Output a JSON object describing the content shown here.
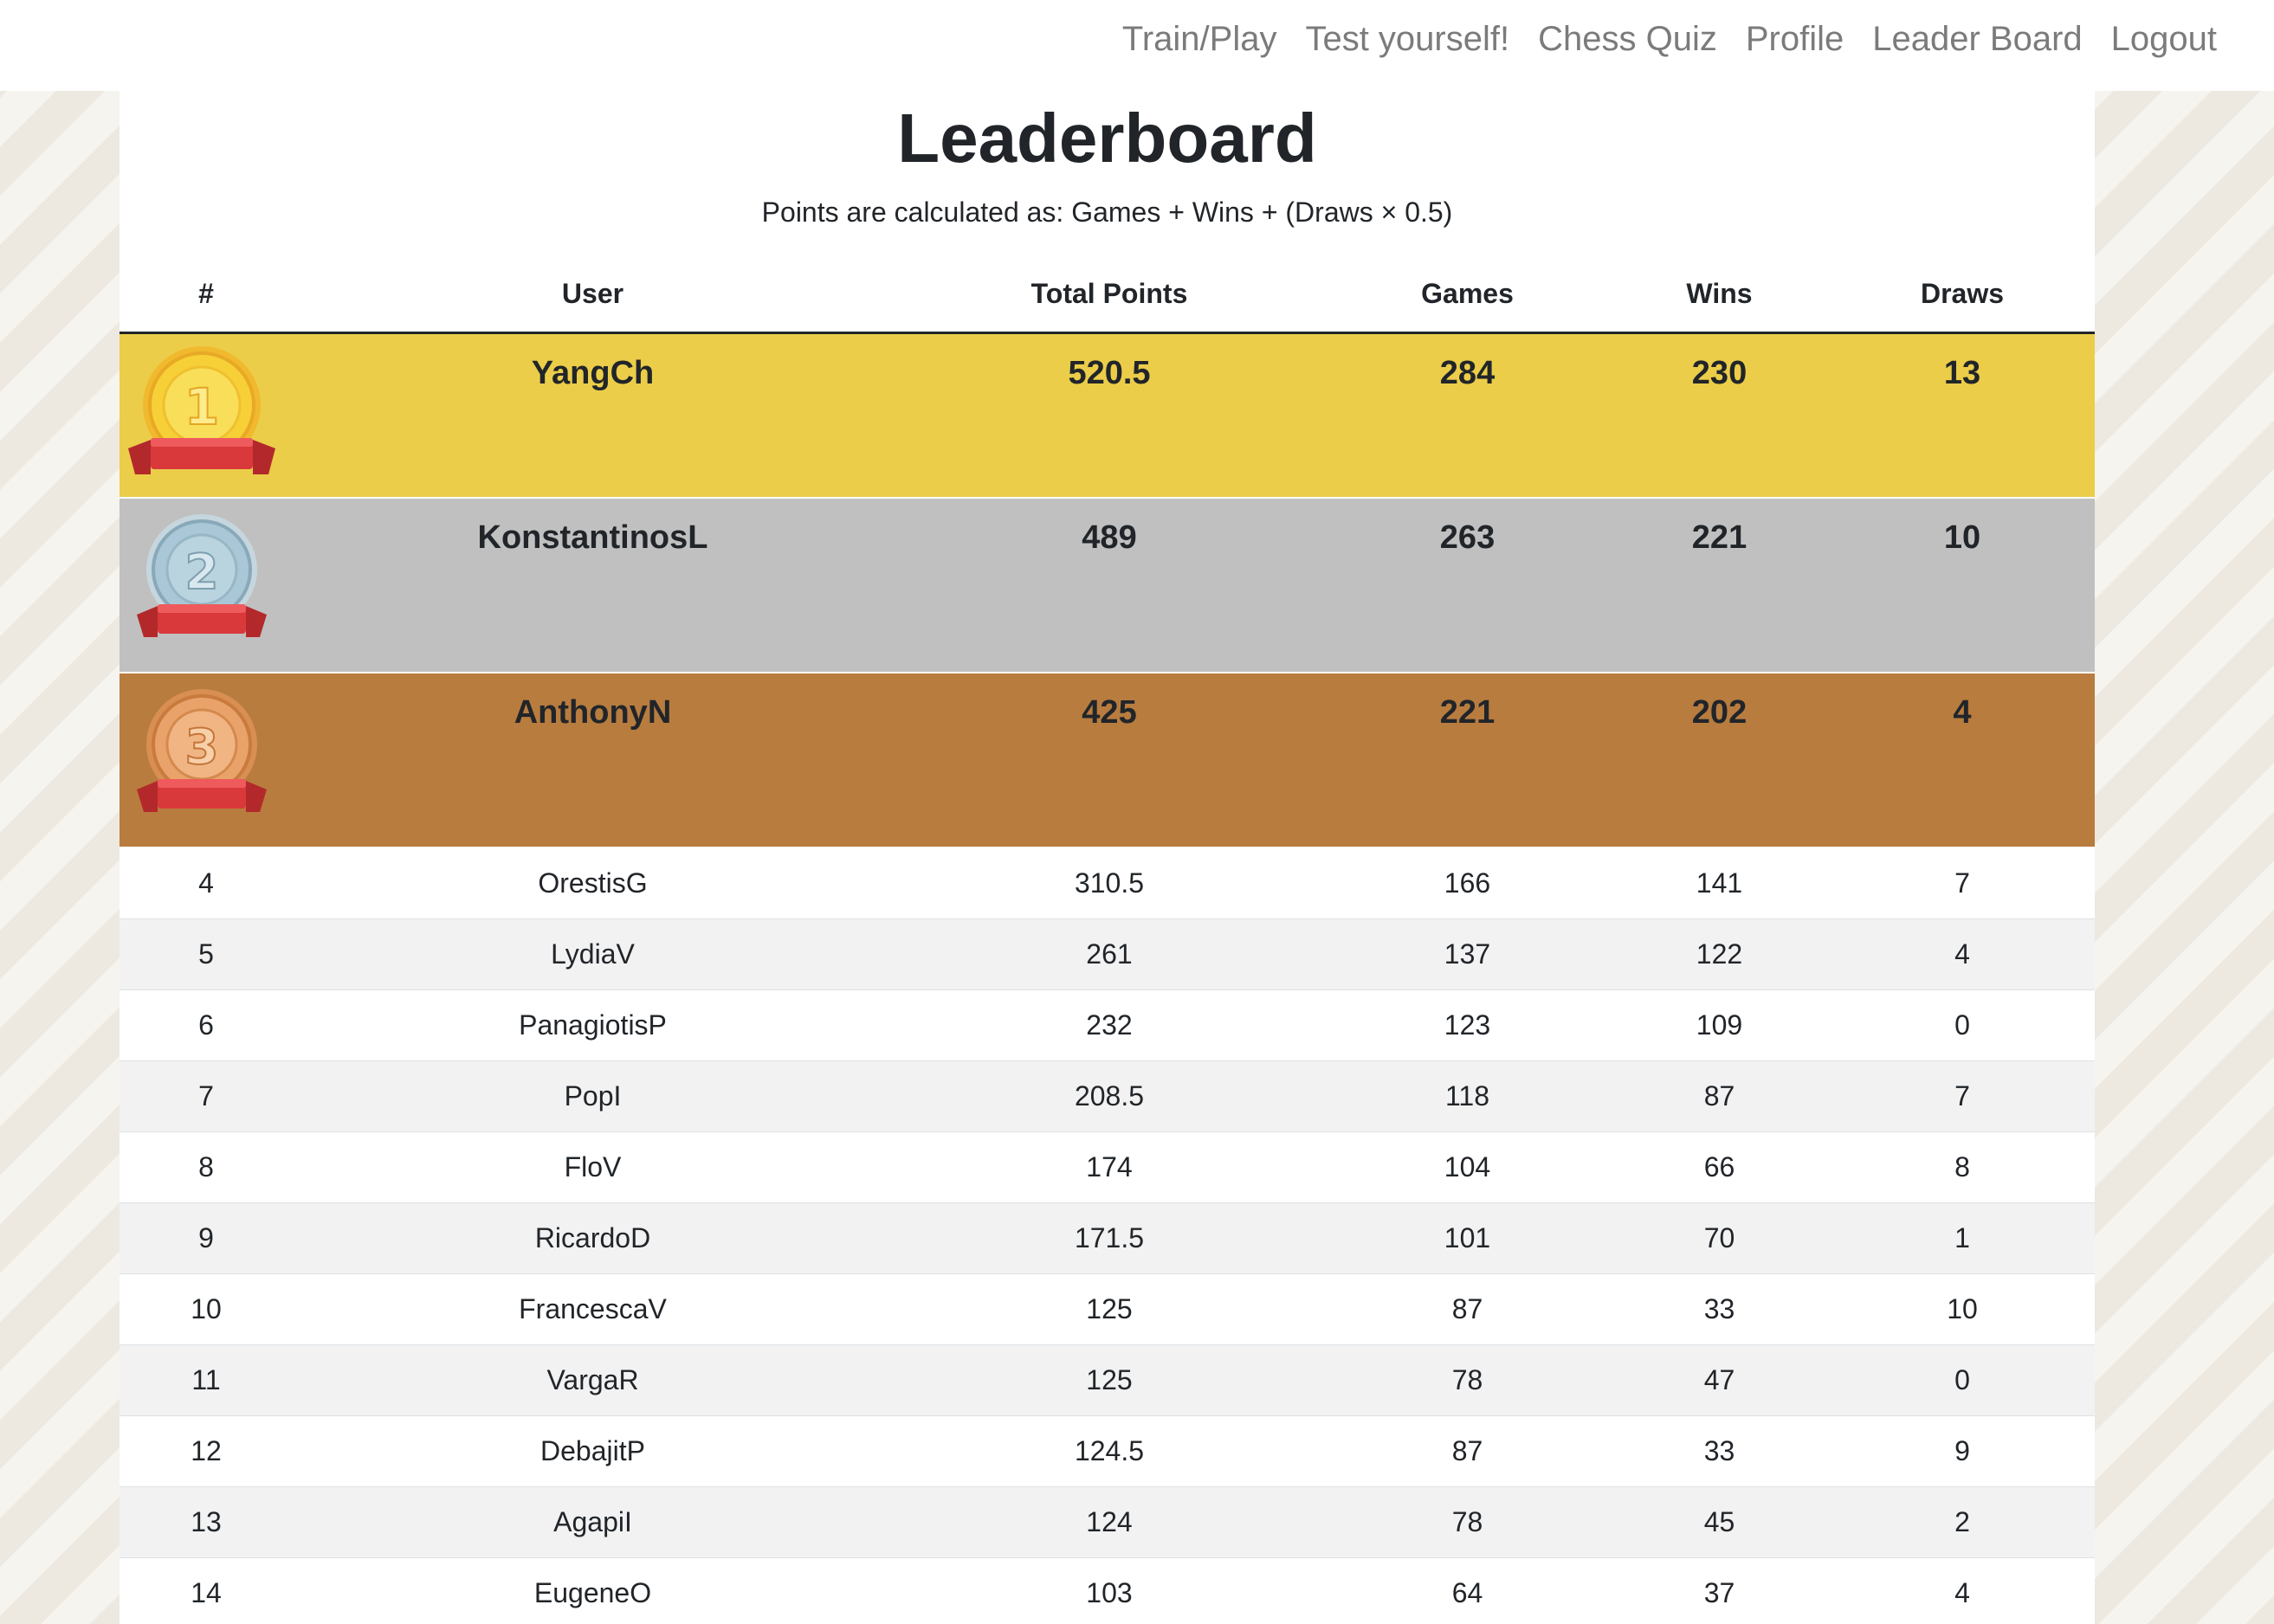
{
  "nav": {
    "items": [
      "Train/Play",
      "Test yourself!",
      "Chess Quiz",
      "Profile",
      "Leader Board",
      "Logout"
    ]
  },
  "page": {
    "title": "Leaderboard",
    "subtitle": "Points are calculated as: Games + Wins + (Draws × 0.5)"
  },
  "table": {
    "headers": [
      "#",
      "User",
      "Total Points",
      "Games",
      "Wins",
      "Draws"
    ],
    "podium": [
      {
        "rank": 1,
        "medal": "gold-medal-icon",
        "user": "YangCh",
        "points": "520.5",
        "games": "284",
        "wins": "230",
        "draws": "13"
      },
      {
        "rank": 2,
        "medal": "silver-medal-icon",
        "user": "KonstantinosL",
        "points": "489",
        "games": "263",
        "wins": "221",
        "draws": "10"
      },
      {
        "rank": 3,
        "medal": "bronze-medal-icon",
        "user": "AnthonyN",
        "points": "425",
        "games": "221",
        "wins": "202",
        "draws": "4"
      }
    ],
    "rows": [
      {
        "rank": "4",
        "user": "OrestisG",
        "points": "310.5",
        "games": "166",
        "wins": "141",
        "draws": "7"
      },
      {
        "rank": "5",
        "user": "LydiaV",
        "points": "261",
        "games": "137",
        "wins": "122",
        "draws": "4"
      },
      {
        "rank": "6",
        "user": "PanagiotisP",
        "points": "232",
        "games": "123",
        "wins": "109",
        "draws": "0"
      },
      {
        "rank": "7",
        "user": "PopI",
        "points": "208.5",
        "games": "118",
        "wins": "87",
        "draws": "7"
      },
      {
        "rank": "8",
        "user": "FloV",
        "points": "174",
        "games": "104",
        "wins": "66",
        "draws": "8"
      },
      {
        "rank": "9",
        "user": "RicardoD",
        "points": "171.5",
        "games": "101",
        "wins": "70",
        "draws": "1"
      },
      {
        "rank": "10",
        "user": "FrancescaV",
        "points": "125",
        "games": "87",
        "wins": "33",
        "draws": "10"
      },
      {
        "rank": "11",
        "user": "VargaR",
        "points": "125",
        "games": "78",
        "wins": "47",
        "draws": "0"
      },
      {
        "rank": "12",
        "user": "DebajitP",
        "points": "124.5",
        "games": "87",
        "wins": "33",
        "draws": "9"
      },
      {
        "rank": "13",
        "user": "AgapiI",
        "points": "124",
        "games": "78",
        "wins": "45",
        "draws": "2"
      },
      {
        "rank": "14",
        "user": "EugeneO",
        "points": "103",
        "games": "64",
        "wins": "37",
        "draws": "4"
      }
    ]
  },
  "colors": {
    "gold_row": "#ebcd49",
    "silver_row": "#c0c0c0",
    "bronze_row": "#b87c3f",
    "ribbon": "#d9393b",
    "gold_medal": "#f3c623",
    "silver_medal": "#a9c7d6",
    "bronze_medal": "#e9a36a"
  }
}
